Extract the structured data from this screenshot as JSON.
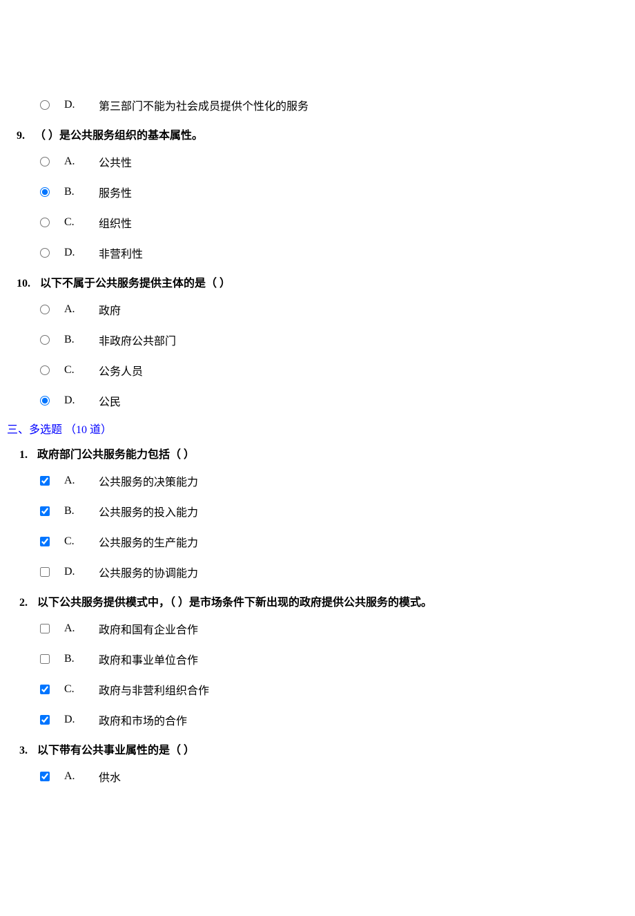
{
  "fragment": {
    "letter": "D.",
    "text": "第三部门不能为社会成员提供个性化的服务"
  },
  "q9": {
    "num": "9.",
    "text": "（ ）是公共服务组织的基本属性。",
    "opts": [
      {
        "letter": "A.",
        "text": "公共性"
      },
      {
        "letter": "B.",
        "text": "服务性"
      },
      {
        "letter": "C.",
        "text": "组织性"
      },
      {
        "letter": "D.",
        "text": "非营利性"
      }
    ]
  },
  "q10": {
    "num": "10.",
    "text": "以下不属于公共服务提供主体的是（ ）",
    "opts": [
      {
        "letter": "A.",
        "text": "政府"
      },
      {
        "letter": "B.",
        "text": "非政府公共部门"
      },
      {
        "letter": "C.",
        "text": "公务人员"
      },
      {
        "letter": "D.",
        "text": "公民"
      }
    ]
  },
  "section": "三、多选题 （10 道）",
  "m1": {
    "num": "1.",
    "text": "政府部门公共服务能力包括（ ）",
    "opts": [
      {
        "letter": "A.",
        "text": "公共服务的决策能力"
      },
      {
        "letter": "B.",
        "text": "公共服务的投入能力"
      },
      {
        "letter": "C.",
        "text": "公共服务的生产能力"
      },
      {
        "letter": "D.",
        "text": "公共服务的协调能力"
      }
    ]
  },
  "m2": {
    "num": "2.",
    "text": "以下公共服务提供模式中，（ ）是市场条件下新出现的政府提供公共服务的模式。",
    "opts": [
      {
        "letter": "A.",
        "text": "政府和国有企业合作"
      },
      {
        "letter": "B.",
        "text": "政府和事业单位合作"
      },
      {
        "letter": "C.",
        "text": "政府与非营利组织合作"
      },
      {
        "letter": "D.",
        "text": "政府和市场的合作"
      }
    ]
  },
  "m3": {
    "num": "3.",
    "text": "以下带有公共事业属性的是（ ）",
    "opts": [
      {
        "letter": "A.",
        "text": "供水"
      }
    ]
  }
}
